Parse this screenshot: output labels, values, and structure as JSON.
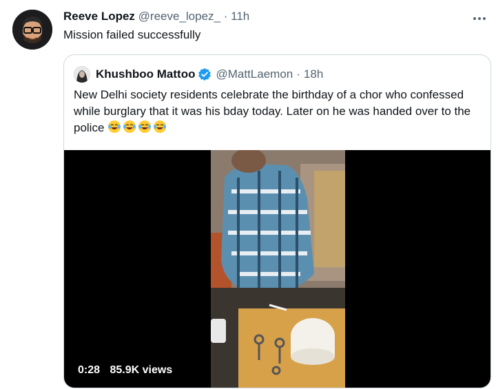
{
  "tweet": {
    "author_name": "Reeve Lopez",
    "author_handle": "@reeve_lopez_",
    "separator": "·",
    "time": "11h",
    "text": "Mission failed successfully",
    "more_icon": "more-icon"
  },
  "quote": {
    "author_name": "Khushboo Mattoo",
    "author_handle": "@MattLaemon",
    "separator": "·",
    "time": "18h",
    "text": "New Delhi society residents celebrate the birthday of a chor who confessed while burglary that it was his bday today. Later on he was handed over to the police",
    "emojis": [
      "face-with-tears-of-joy",
      "face-with-tears-of-joy",
      "face-with-tears-of-joy",
      "face-with-tears-of-joy"
    ],
    "video": {
      "duration": "0:28",
      "views": "85.9K views"
    }
  },
  "colors": {
    "verified": "#1d9bf0",
    "secondary_text": "#536471",
    "border": "#cfd9de"
  }
}
